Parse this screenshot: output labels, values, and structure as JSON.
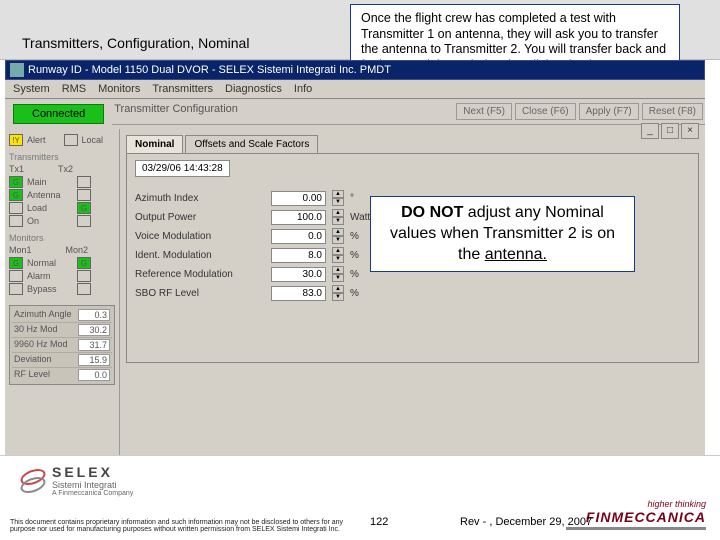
{
  "breadcrumb": "Transmitters, Configuration, Nominal",
  "callout_top": "Once the flight crew has completed a test with Transmitter 1 on antenna, they will ask you to transfer the antenna to Transmitter 2. You will transfer back and forth several times during the Flight Check.",
  "callout_mid_bold": "DO NOT",
  "callout_mid_rest1": " adjust any Nominal values when Transmitter 2 is on the ",
  "callout_mid_rest2": "antenna.",
  "app": {
    "title": "Runway ID - Model 1150 Dual DVOR - SELEX Sistemi Integrati Inc. PMDT",
    "menus": [
      "System",
      "RMS",
      "Monitors",
      "Transmitters",
      "Diagnostics",
      "Info"
    ],
    "connected": "Connected",
    "panel_title": "Transmitter Configuration",
    "right_buttons": [
      "Next (F5)",
      "Close (F6)",
      "Apply (F7)",
      "Reset (F8)"
    ],
    "tabs": [
      "Nominal",
      "Offsets and Scale Factors"
    ],
    "timestamp": "03/29/06 14:43:28",
    "params": [
      {
        "label": "Azimuth Index",
        "value": "0.00",
        "unit": "°"
      },
      {
        "label": "Output Power",
        "value": "100.0",
        "unit": "Watts"
      },
      {
        "label": "Voice Modulation",
        "value": "0.0",
        "unit": "%"
      },
      {
        "label": "Ident. Modulation",
        "value": "8.0",
        "unit": "%"
      },
      {
        "label": "Reference Modulation",
        "value": "30.0",
        "unit": "%"
      },
      {
        "label": "SBO RF Level",
        "value": "83.0",
        "unit": "%"
      }
    ]
  },
  "sidebar": {
    "alert_label": "Alert",
    "local_label": "Local",
    "tx_header": "Transmitters",
    "tx_cols": [
      "Tx1",
      "Tx2"
    ],
    "tx_rows": [
      "Main",
      "Antenna",
      "Load",
      "On"
    ],
    "mon_header": "Monitors",
    "mon_cols": [
      "Mon1",
      "Mon2"
    ],
    "mon_rows": [
      "Normal",
      "Alarm",
      "Bypass"
    ],
    "rf": [
      {
        "label": "Azimuth Angle",
        "value": "0.3"
      },
      {
        "label": "30 Hz Mod",
        "value": "30.2"
      },
      {
        "label": "9960 Hz Mod",
        "value": "31.7"
      },
      {
        "label": "Deviation",
        "value": "15.9"
      },
      {
        "label": "RF Level",
        "value": "0.0"
      }
    ]
  },
  "footer": {
    "selex_name": "SELEX",
    "selex_sub1": "Sistemi Integrati",
    "selex_sub2": "A Finmeccanica Company",
    "fin_t1": "higher thinking",
    "fin_t2": "FINMECCANICA",
    "proprietary": "This document contains proprietary information and such information may not be disclosed to others for any purpose nor used for manufacturing purposes without written permission from SELEX Sistemi Integrati Inc.",
    "page": "122",
    "rev": "Rev - , December 29, 2007"
  },
  "chart_data": {
    "type": "table",
    "title": "Transmitter Configuration — Nominal",
    "columns": [
      "Parameter",
      "Value",
      "Unit"
    ],
    "rows": [
      [
        "Azimuth Index",
        "0.00",
        "°"
      ],
      [
        "Output Power",
        "100.0",
        "Watts"
      ],
      [
        "Voice Modulation",
        "0.0",
        "%"
      ],
      [
        "Ident. Modulation",
        "8.0",
        "%"
      ],
      [
        "Reference Modulation",
        "30.0",
        "%"
      ],
      [
        "SBO RF Level",
        "83.0",
        "%"
      ]
    ]
  }
}
